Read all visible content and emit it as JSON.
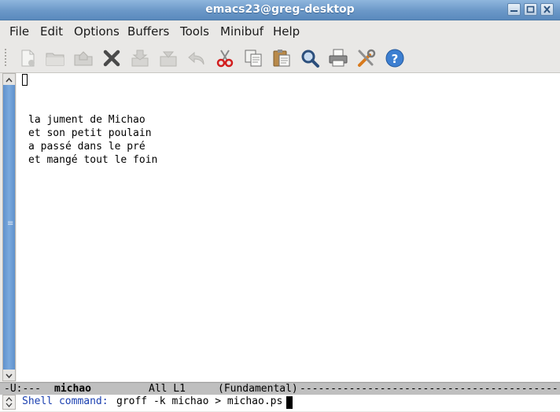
{
  "window": {
    "title": "emacs23@greg-desktop"
  },
  "menu": {
    "items": [
      "File",
      "Edit",
      "Options",
      "Buffers",
      "Tools",
      "Minibuf",
      "Help"
    ]
  },
  "toolbar": {
    "icons": [
      "new-file-icon",
      "open-file-icon",
      "dired-icon",
      "close-buffer-icon",
      "save-icon",
      "save-as-icon",
      "undo-icon",
      "cut-icon",
      "copy-icon",
      "paste-icon",
      "search-icon",
      "print-icon",
      "preferences-icon",
      "help-icon"
    ]
  },
  "buffer": {
    "lines": [
      "la jument de Michao",
      "et son petit poulain",
      "a passé dans le pré",
      "et mangé tout le foin"
    ]
  },
  "modeline": {
    "status": "-U:---",
    "buffer_name": "michao",
    "position": "All L1",
    "mode": "(Fundamental)",
    "dashes": "------------------------------------------------------------"
  },
  "minibuffer": {
    "prompt": "Shell command:",
    "value": "groff -k michao > michao.ps"
  },
  "colors": {
    "titlebar": "#6b98c8",
    "prompt": "#1a3fb0",
    "scroll_thumb": "#6a9bd4"
  }
}
